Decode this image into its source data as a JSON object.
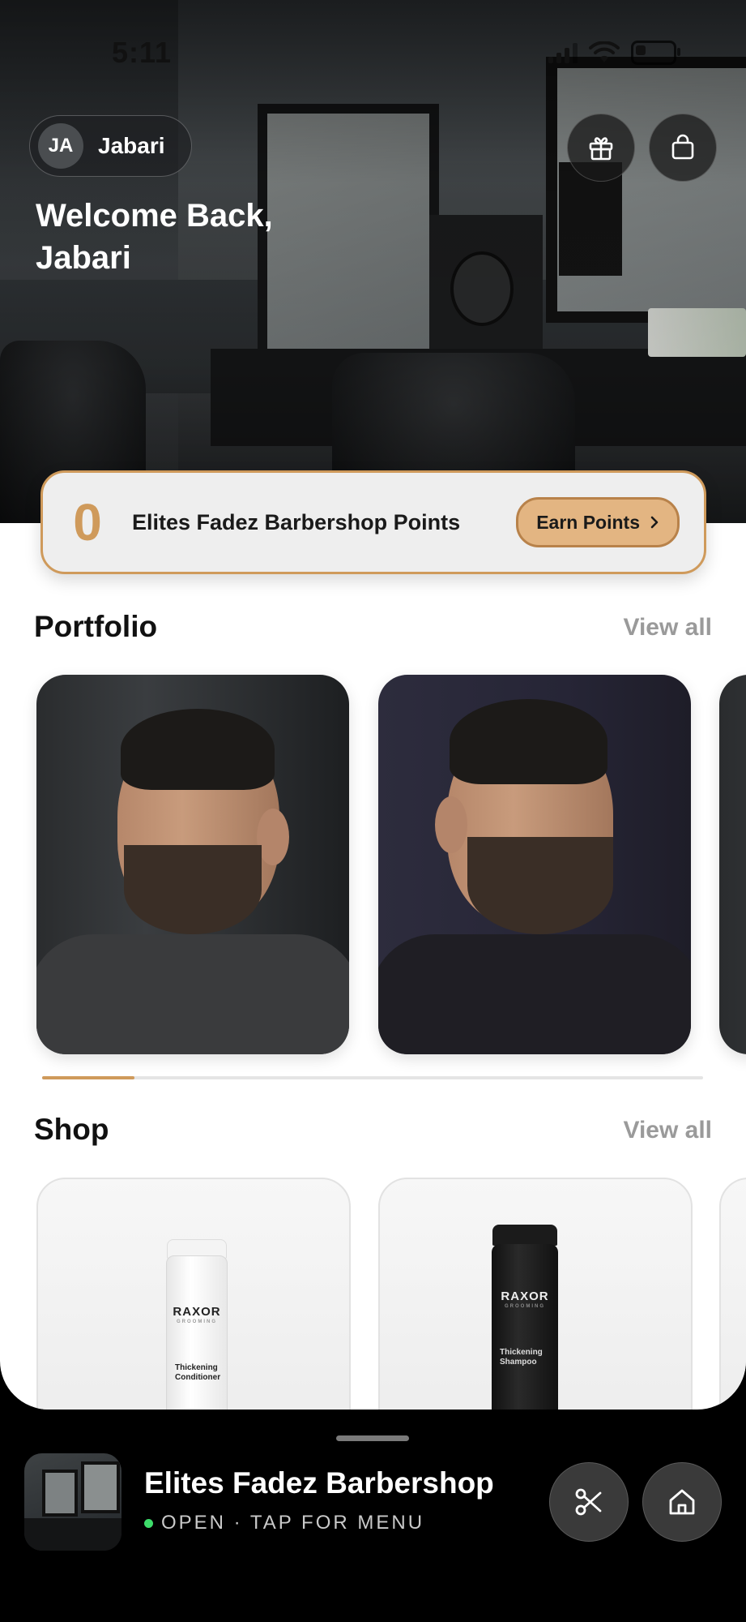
{
  "status_bar": {
    "time": "5:11",
    "icons": [
      "signal-icon",
      "wifi-icon",
      "battery-icon"
    ]
  },
  "user": {
    "initials": "JA",
    "name": "Jabari"
  },
  "header": {
    "welcome_line1": "Welcome Back,",
    "welcome_line2": "Jabari",
    "icons": [
      "gift-icon",
      "shopping-bag-icon"
    ]
  },
  "points": {
    "value": "0",
    "label": "Elites Fadez Barbershop Points",
    "button_label": "Earn Points"
  },
  "portfolio": {
    "title": "Portfolio",
    "view_all": "View all",
    "scroll_progress": 0.14
  },
  "shop": {
    "title": "Shop",
    "view_all": "View all",
    "products": [
      {
        "brand": "RAXOR",
        "sub": "GROOMING",
        "name": "Thickening Conditioner",
        "color": "#ffffff"
      },
      {
        "brand": "RAXOR",
        "sub": "GROOMING",
        "name": "Thickening Shampoo",
        "color": "#1a1a1a"
      }
    ]
  },
  "bottom_sheet": {
    "shop_name": "Elites Fadez Barbershop",
    "status": "OPEN · TAP FOR MENU",
    "icons": [
      "scissors-icon",
      "home-icon"
    ]
  },
  "colors": {
    "accent": "#cf9a5b",
    "open": "#3ddc6a"
  }
}
